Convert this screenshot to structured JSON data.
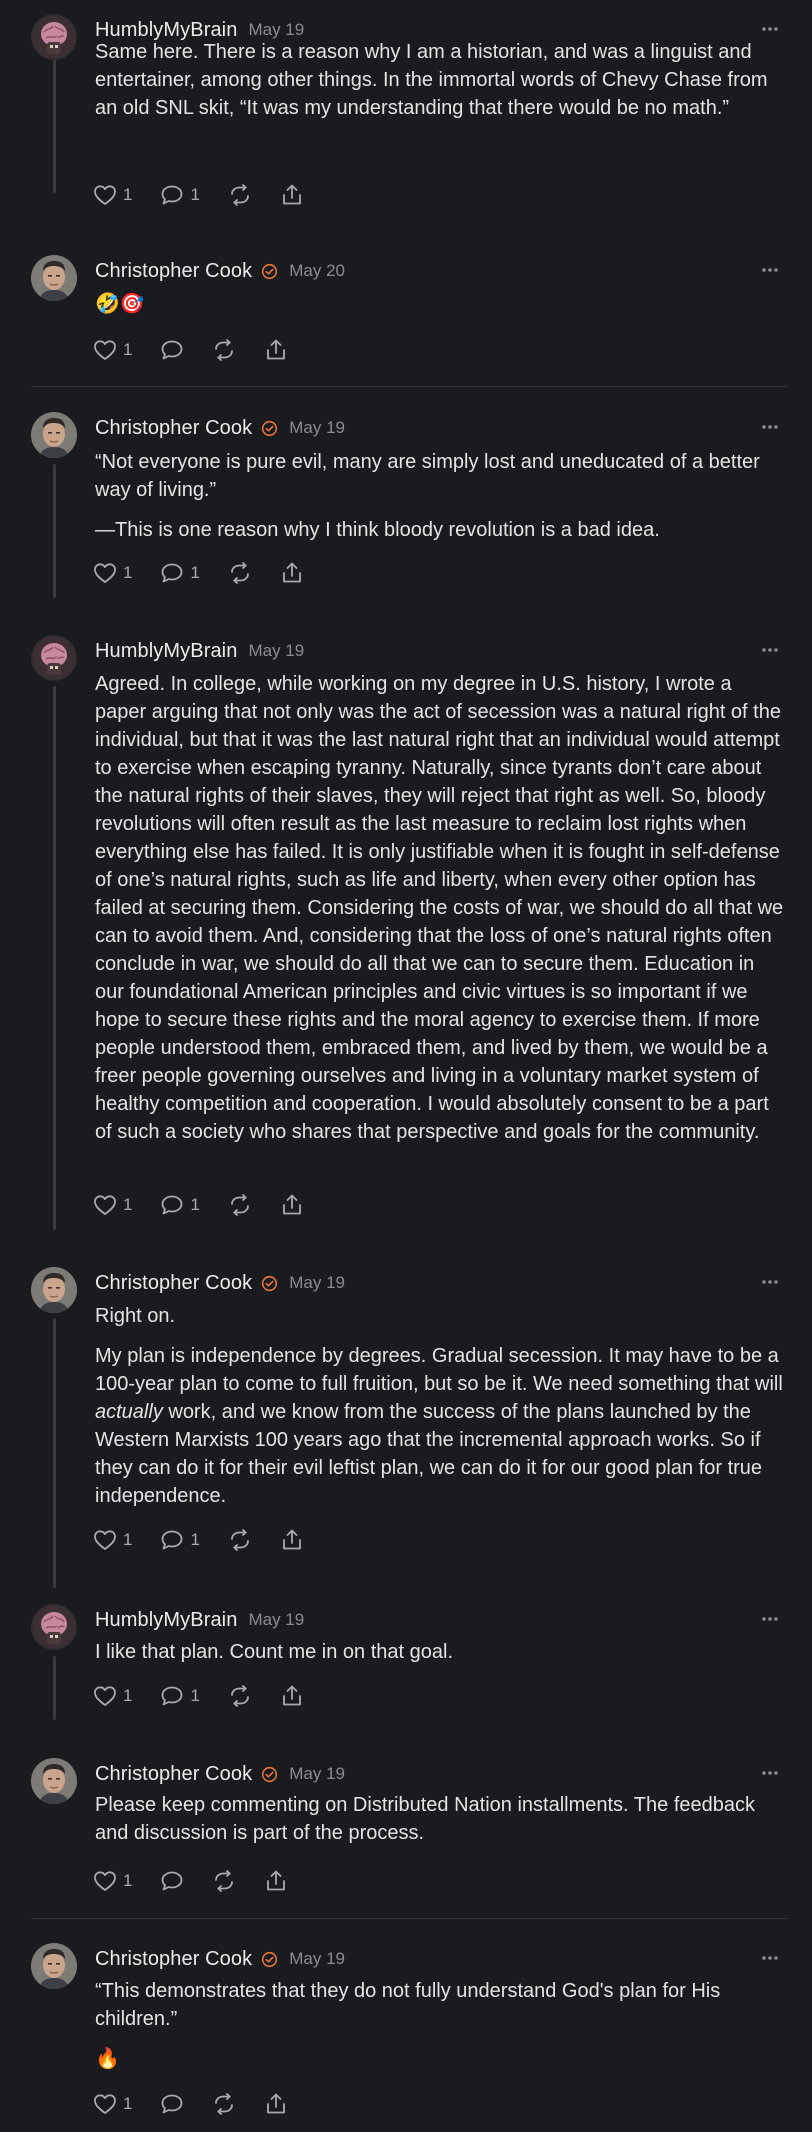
{
  "comments": [
    {
      "author": "HumblyMyBrain",
      "date": "May 19",
      "avatar": "brain-avatar",
      "verified": false,
      "paragraphs": [
        "Same here. There is a reason why I am a historian, and was a linguist and entertainer, among other things. In the immortal words of Chevy Chase from an old SNL skit, “It was my understanding that there would be no math.”"
      ],
      "likes": "1",
      "replies": "1"
    },
    {
      "author": "Christopher Cook",
      "date": "May 20",
      "avatar": "man-avatar",
      "verified": true,
      "paragraphs": [
        "🤣🎯"
      ],
      "likes": "1",
      "replies": ""
    },
    {
      "author": "Christopher Cook",
      "date": "May 19",
      "avatar": "man-avatar",
      "verified": true,
      "paragraphs": [
        "“Not everyone is pure evil, many are simply lost and uneducated of a better way of living.”",
        "—This is one reason why I think bloody revolution is a bad idea."
      ],
      "likes": "1",
      "replies": "1"
    },
    {
      "author": "HumblyMyBrain",
      "date": "May 19",
      "avatar": "brain-avatar",
      "verified": false,
      "paragraphs": [
        "Agreed. In college, while working on my degree in U.S. history, I wrote a paper arguing that not only was the act of secession was a natural right of the individual, but that it was the last natural right that an individual would attempt to exercise when escaping tyranny. Naturally, since tyrants don’t care about the natural rights of their slaves, they will reject that right as well. So, bloody revolutions will often result as the last measure to reclaim lost rights when everything else has failed. It is only justifiable when it is fought in self-defense of one’s natural rights, such as life and liberty, when every other option has failed at securing them. Considering the costs of war, we should do all that we can to avoid them. And, considering that the loss of one’s natural rights often conclude in war, we should do all that we can to secure them. Education in our foundational American principles and civic virtues is so important if we hope to secure these rights and the moral agency to exercise them. If more people understood them, embraced them, and lived by them, we would be a freer people governing ourselves and living in a voluntary market system of healthy competition and cooperation. I would absolutely consent to be a part of such a society who shares that perspective and goals for the community."
      ],
      "likes": "1",
      "replies": "1"
    },
    {
      "author": "Christopher Cook",
      "date": "May 19",
      "avatar": "man-avatar",
      "verified": true,
      "paragraphs": [
        "Right on.",
        "My plan is independence by degrees. Gradual secession. It may have to be a 100-year plan to come to full fruition, but so be it. We need something that will ",
        "actually",
        " work, and we know from the success of the plans launched by the Western Marxists 100 years ago that the incremental approach works. So if they can do it for their evil leftist plan, we can do it for our good plan for true independence."
      ],
      "likes": "1",
      "replies": "1"
    },
    {
      "author": "HumblyMyBrain",
      "date": "May 19",
      "avatar": "brain-avatar",
      "verified": false,
      "paragraphs": [
        "I like that plan. Count me in on that goal."
      ],
      "likes": "1",
      "replies": "1"
    },
    {
      "author": "Christopher Cook",
      "date": "May 19",
      "avatar": "man-avatar",
      "verified": true,
      "paragraphs": [
        "Please keep commenting on Distributed Nation installments. The feedback and discussion is part of the process."
      ],
      "likes": "1",
      "replies": ""
    },
    {
      "author": "Christopher Cook",
      "date": "May 19",
      "avatar": "man-avatar",
      "verified": true,
      "paragraphs": [
        "“This demonstrates that they do not fully understand God's plan for His children.”",
        "🔥"
      ],
      "likes": "1",
      "replies": ""
    }
  ],
  "colors": {
    "background": "#1a1b1e",
    "verified_badge": "#e8763b",
    "muted_text": "#8b8c91"
  }
}
